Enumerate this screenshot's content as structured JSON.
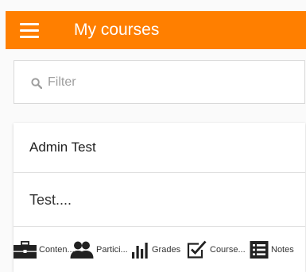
{
  "app_bar": {
    "title": "My courses",
    "color": "#ff7f00",
    "menu_icon": "hamburger-menu-icon"
  },
  "filter": {
    "placeholder": "Filter",
    "value": "",
    "icon": "search-icon"
  },
  "course": {
    "name": "Admin Test",
    "summary": "Test....",
    "tabs": [
      {
        "label": "Conten...",
        "icon": "briefcase-icon"
      },
      {
        "label": "Partici...",
        "icon": "people-icon"
      },
      {
        "label": "Grades",
        "icon": "bar-chart-icon"
      },
      {
        "label": "Course...",
        "icon": "checkbox-icon"
      },
      {
        "label": "Notes",
        "icon": "list-icon"
      }
    ]
  }
}
